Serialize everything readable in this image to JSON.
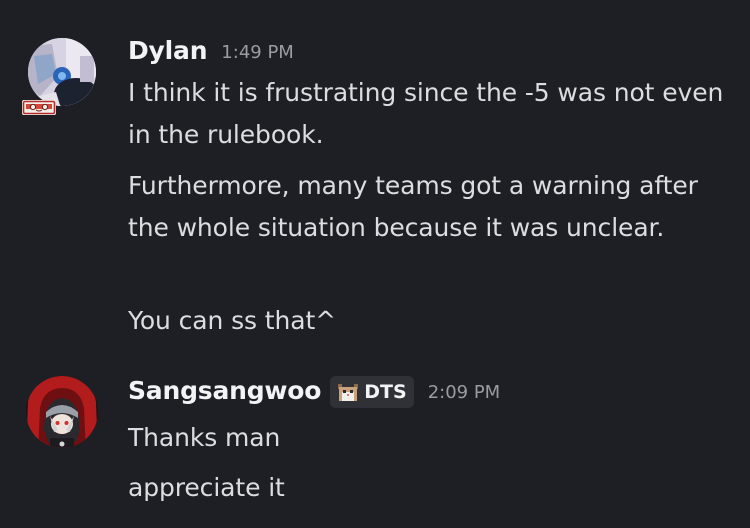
{
  "messages": [
    {
      "author": "Dylan",
      "time": "1:49 PM",
      "lines": [
        "I think it is frustrating since the -5 was not even in the rulebook.",
        "Furthermore, many teams got a warning after the whole situation because it was unclear.",
        "You can ss that^"
      ]
    },
    {
      "author": "Sangsangwoo",
      "tag": "DTS",
      "time": "2:09 PM",
      "lines": [
        "Thanks man",
        "appreciate it"
      ]
    }
  ],
  "colors": {
    "background": "#1e1f24",
    "username": "#f2f3f5",
    "message_text": "#dbdee1",
    "timestamp": "#9a9ca3",
    "tag_background": "#303137"
  },
  "icons": {
    "dylan_avatar": "user-avatar",
    "dylan_badge": "cassette-badge-icon",
    "sangsangwoo_avatar": "user-avatar",
    "tag_icon": "cat-icon"
  }
}
